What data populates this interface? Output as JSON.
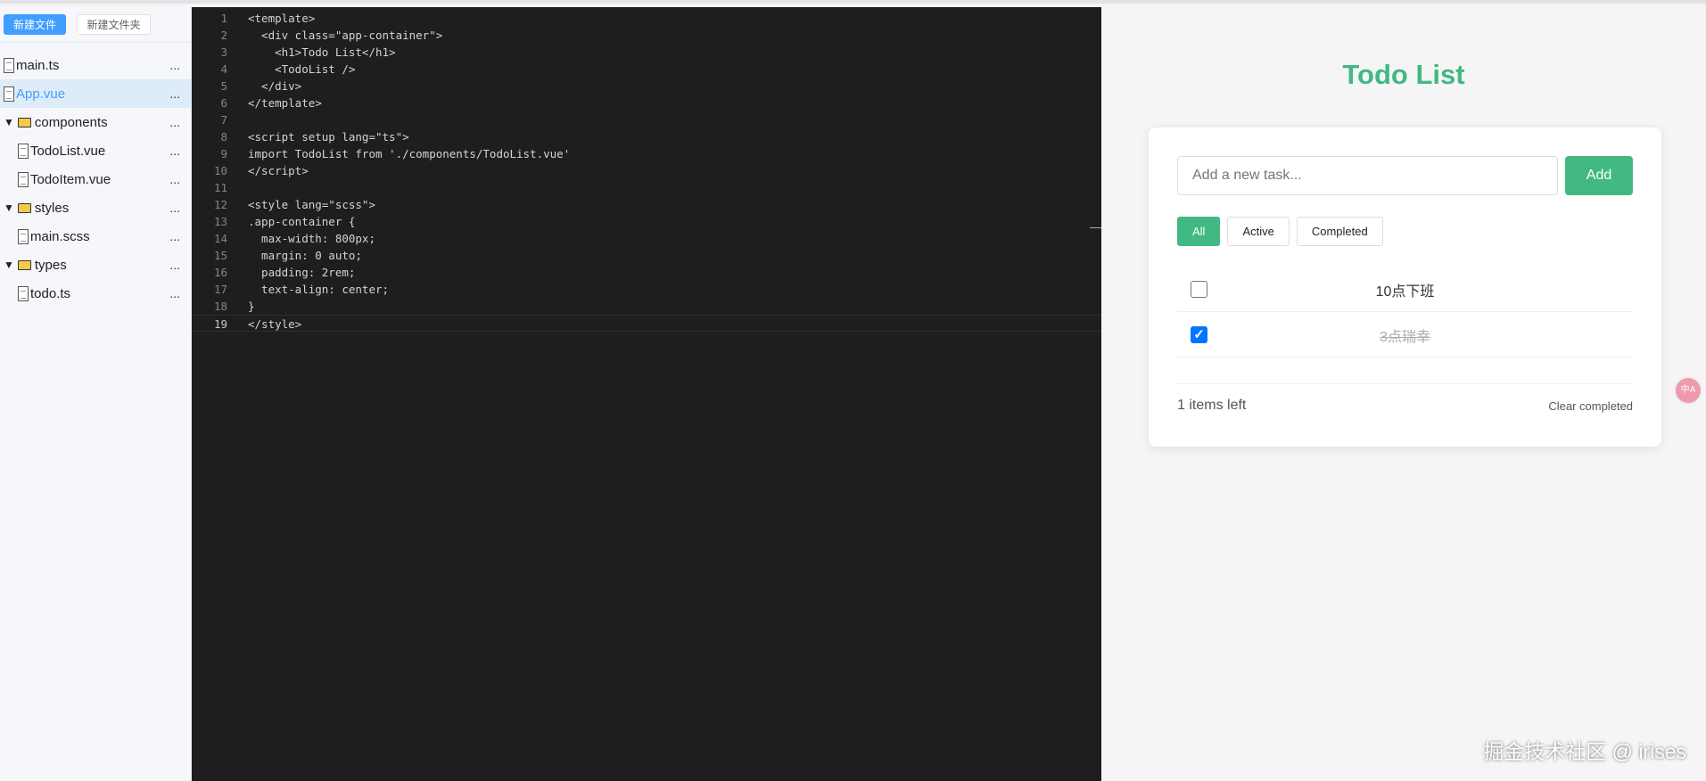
{
  "sidebar": {
    "new_file": "新建文件",
    "new_folder": "新建文件夹",
    "items": [
      {
        "label": "main.ts",
        "type": "file",
        "more": "..."
      },
      {
        "label": "App.vue",
        "type": "file",
        "more": "..."
      },
      {
        "label": "components",
        "type": "folder",
        "more": "..."
      },
      {
        "label": "TodoList.vue",
        "type": "file",
        "more": "..."
      },
      {
        "label": "TodoItem.vue",
        "type": "file",
        "more": "..."
      },
      {
        "label": "styles",
        "type": "folder",
        "more": "..."
      },
      {
        "label": "main.scss",
        "type": "file",
        "more": "..."
      },
      {
        "label": "types",
        "type": "folder",
        "more": "..."
      },
      {
        "label": "todo.ts",
        "type": "file",
        "more": "..."
      }
    ]
  },
  "editor": {
    "lines": [
      "<template>",
      "  <div class=\"app-container\">",
      "    <h1>Todo List</h1>",
      "    <TodoList />",
      "  </div>",
      "</template>",
      "",
      "<script setup lang=\"ts\">",
      "import TodoList from './components/TodoList.vue'",
      "</script>",
      "",
      "<style lang=\"scss\">",
      ".app-container {",
      "  max-width: 800px;",
      "  margin: 0 auto;",
      "  padding: 2rem;",
      "  text-align: center;",
      "}",
      "</style>"
    ]
  },
  "preview": {
    "title": "Todo List",
    "input_placeholder": "Add a new task...",
    "add_label": "Add",
    "filters": [
      "All",
      "Active",
      "Completed"
    ],
    "todos": [
      {
        "text": "10点下班",
        "done": false
      },
      {
        "text": "3点瑞幸",
        "done": true
      }
    ],
    "items_left": "1 items left",
    "clear_completed": "Clear completed"
  },
  "translate_icon_text": "中A",
  "watermark": "掘金技术社区 @ irises"
}
